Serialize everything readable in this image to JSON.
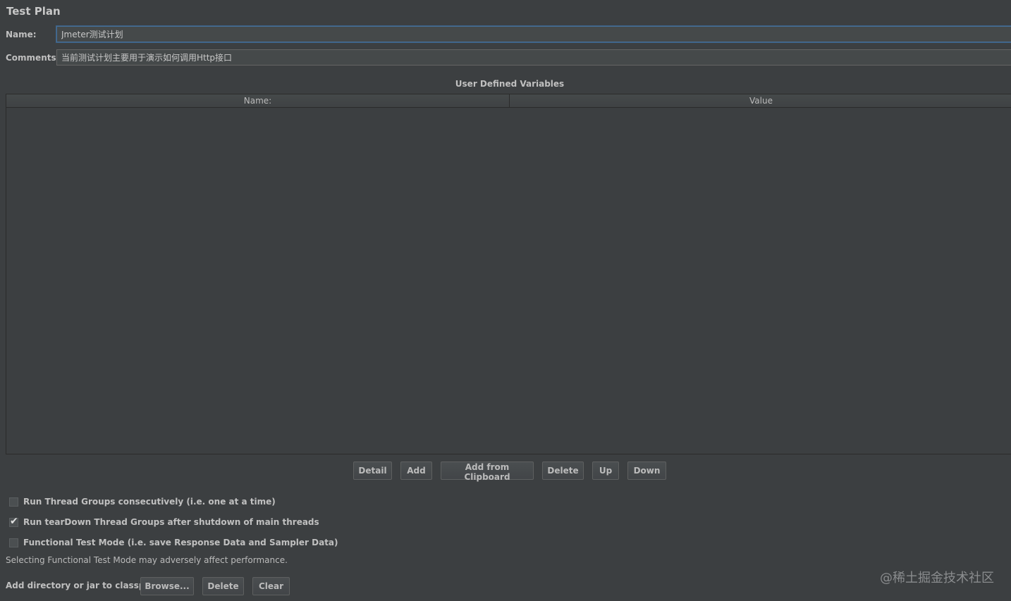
{
  "panel": {
    "title": "Test Plan"
  },
  "form": {
    "name_label": "Name:",
    "name_value": "Jmeter测试计划",
    "comments_label": "Comments:",
    "comments_value": "当前测试计划主要用于演示如何调用Http接口"
  },
  "variables": {
    "title": "User Defined Variables",
    "columns": [
      "Name:",
      "Value"
    ],
    "rows": []
  },
  "table_buttons": {
    "detail": "Detail",
    "add": "Add",
    "add_from_clipboard": "Add from Clipboard",
    "delete": "Delete",
    "up": "Up",
    "down": "Down"
  },
  "options": [
    {
      "label": "Run Thread Groups consecutively (i.e. one at a time)",
      "checked": false
    },
    {
      "label": "Run tearDown Thread Groups after shutdown of main threads",
      "checked": true
    },
    {
      "label": "Functional Test Mode (i.e. save Response Data and Sampler Data)",
      "checked": false
    }
  ],
  "functional_note": "Selecting Functional Test Mode may adversely affect performance.",
  "classpath": {
    "label": "Add directory or jar to classpath",
    "browse": "Browse...",
    "delete": "Delete",
    "clear": "Clear"
  },
  "watermark": "@稀土掘金技术社区",
  "colors": {
    "background": "#3c3f41",
    "input_background": "#45494a",
    "focus_border": "#466d94",
    "text": "#bbbbbb"
  }
}
